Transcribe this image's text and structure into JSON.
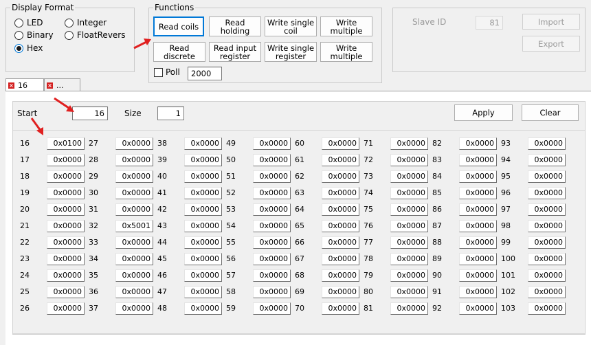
{
  "display_format": {
    "title": "Display Format",
    "options": [
      {
        "label": "LED",
        "checked": false
      },
      {
        "label": "Binary",
        "checked": false
      },
      {
        "label": "Hex",
        "checked": true
      },
      {
        "label": "Integer",
        "checked": false
      },
      {
        "label": "FloatRevers",
        "checked": false
      }
    ]
  },
  "functions": {
    "title": "Functions",
    "buttons": [
      {
        "label": "Read coils"
      },
      {
        "label": "Read\nholding"
      },
      {
        "label": "Write single\ncoil"
      },
      {
        "label": "Write\nmultiple"
      },
      {
        "label": "Read\ndiscrete"
      },
      {
        "label": "Read input\nregister"
      },
      {
        "label": "Write single\nregister"
      },
      {
        "label": "Write\nmultiple"
      }
    ],
    "poll_label": "Poll",
    "poll_checked": false,
    "poll_value": "2000"
  },
  "slave": {
    "label": "Slave ID",
    "value": "81",
    "import_label": "Import",
    "export_label": "Export"
  },
  "tabs": [
    {
      "label": "16",
      "active": true
    },
    {
      "label": "...",
      "active": false
    }
  ],
  "toolbar": {
    "start_label": "Start",
    "start_value": "16",
    "size_label": "Size",
    "size_value": "1",
    "apply_label": "Apply",
    "clear_label": "Clear"
  },
  "registers": [
    {
      "addr": "16",
      "value": "0x0100"
    },
    {
      "addr": "17",
      "value": "0x0000"
    },
    {
      "addr": "18",
      "value": "0x0000"
    },
    {
      "addr": "19",
      "value": "0x0000"
    },
    {
      "addr": "20",
      "value": "0x0000"
    },
    {
      "addr": "21",
      "value": "0x0000"
    },
    {
      "addr": "22",
      "value": "0x0000"
    },
    {
      "addr": "23",
      "value": "0x0000"
    },
    {
      "addr": "24",
      "value": "0x0000"
    },
    {
      "addr": "25",
      "value": "0x0000"
    },
    {
      "addr": "26",
      "value": "0x0000"
    },
    {
      "addr": "27",
      "value": "0x0000"
    },
    {
      "addr": "28",
      "value": "0x0000"
    },
    {
      "addr": "29",
      "value": "0x0000"
    },
    {
      "addr": "30",
      "value": "0x0000"
    },
    {
      "addr": "31",
      "value": "0x0000"
    },
    {
      "addr": "32",
      "value": "0x5001"
    },
    {
      "addr": "33",
      "value": "0x0000"
    },
    {
      "addr": "34",
      "value": "0x0000"
    },
    {
      "addr": "35",
      "value": "0x0000"
    },
    {
      "addr": "36",
      "value": "0x0000"
    },
    {
      "addr": "37",
      "value": "0x0000"
    },
    {
      "addr": "38",
      "value": "0x0000"
    },
    {
      "addr": "39",
      "value": "0x0000"
    },
    {
      "addr": "40",
      "value": "0x0000"
    },
    {
      "addr": "41",
      "value": "0x0000"
    },
    {
      "addr": "42",
      "value": "0x0000"
    },
    {
      "addr": "43",
      "value": "0x0000"
    },
    {
      "addr": "44",
      "value": "0x0000"
    },
    {
      "addr": "45",
      "value": "0x0000"
    },
    {
      "addr": "46",
      "value": "0x0000"
    },
    {
      "addr": "47",
      "value": "0x0000"
    },
    {
      "addr": "48",
      "value": "0x0000"
    },
    {
      "addr": "49",
      "value": "0x0000"
    },
    {
      "addr": "50",
      "value": "0x0000"
    },
    {
      "addr": "51",
      "value": "0x0000"
    },
    {
      "addr": "52",
      "value": "0x0000"
    },
    {
      "addr": "53",
      "value": "0x0000"
    },
    {
      "addr": "54",
      "value": "0x0000"
    },
    {
      "addr": "55",
      "value": "0x0000"
    },
    {
      "addr": "56",
      "value": "0x0000"
    },
    {
      "addr": "57",
      "value": "0x0000"
    },
    {
      "addr": "58",
      "value": "0x0000"
    },
    {
      "addr": "59",
      "value": "0x0000"
    },
    {
      "addr": "60",
      "value": "0x0000"
    },
    {
      "addr": "61",
      "value": "0x0000"
    },
    {
      "addr": "62",
      "value": "0x0000"
    },
    {
      "addr": "63",
      "value": "0x0000"
    },
    {
      "addr": "64",
      "value": "0x0000"
    },
    {
      "addr": "65",
      "value": "0x0000"
    },
    {
      "addr": "66",
      "value": "0x0000"
    },
    {
      "addr": "67",
      "value": "0x0000"
    },
    {
      "addr": "68",
      "value": "0x0000"
    },
    {
      "addr": "69",
      "value": "0x0000"
    },
    {
      "addr": "70",
      "value": "0x0000"
    },
    {
      "addr": "71",
      "value": "0x0000"
    },
    {
      "addr": "72",
      "value": "0x0000"
    },
    {
      "addr": "73",
      "value": "0x0000"
    },
    {
      "addr": "74",
      "value": "0x0000"
    },
    {
      "addr": "75",
      "value": "0x0000"
    },
    {
      "addr": "76",
      "value": "0x0000"
    },
    {
      "addr": "77",
      "value": "0x0000"
    },
    {
      "addr": "78",
      "value": "0x0000"
    },
    {
      "addr": "79",
      "value": "0x0000"
    },
    {
      "addr": "80",
      "value": "0x0000"
    },
    {
      "addr": "81",
      "value": "0x0000"
    },
    {
      "addr": "82",
      "value": "0x0000"
    },
    {
      "addr": "83",
      "value": "0x0000"
    },
    {
      "addr": "84",
      "value": "0x0000"
    },
    {
      "addr": "85",
      "value": "0x0000"
    },
    {
      "addr": "86",
      "value": "0x0000"
    },
    {
      "addr": "87",
      "value": "0x0000"
    },
    {
      "addr": "88",
      "value": "0x0000"
    },
    {
      "addr": "89",
      "value": "0x0000"
    },
    {
      "addr": "90",
      "value": "0x0000"
    },
    {
      "addr": "91",
      "value": "0x0000"
    },
    {
      "addr": "92",
      "value": "0x0000"
    },
    {
      "addr": "93",
      "value": "0x0000"
    },
    {
      "addr": "94",
      "value": "0x0000"
    },
    {
      "addr": "95",
      "value": "0x0000"
    },
    {
      "addr": "96",
      "value": "0x0000"
    },
    {
      "addr": "97",
      "value": "0x0000"
    },
    {
      "addr": "98",
      "value": "0x0000"
    },
    {
      "addr": "99",
      "value": "0x0000"
    },
    {
      "addr": "100",
      "value": "0x0000"
    },
    {
      "addr": "101",
      "value": "0x0000"
    },
    {
      "addr": "102",
      "value": "0x0000"
    },
    {
      "addr": "103",
      "value": "0x0000"
    }
  ],
  "colors": {
    "focus": "#0078d7",
    "annotation_arrow": "#e02020",
    "tab_close": "#d32020"
  }
}
